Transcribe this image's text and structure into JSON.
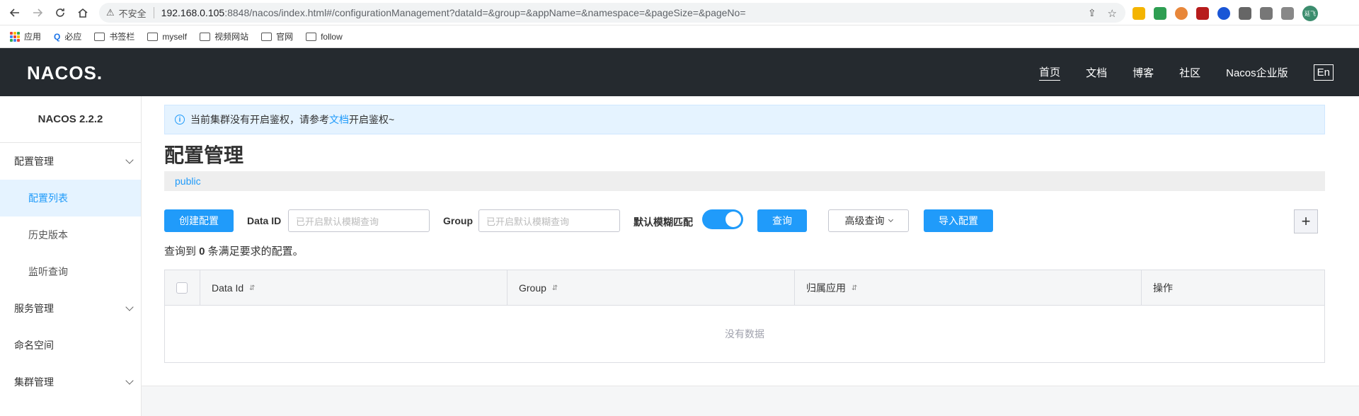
{
  "browser": {
    "security_label": "不安全",
    "url_host": "192.168.0.105",
    "url_rest": ":8848/nacos/index.html#/configurationManagement?dataId=&group=&appName=&namespace=&pageSize=&pageNo=",
    "avatar_text": "延飞"
  },
  "bookmarks": [
    {
      "label": "应用"
    },
    {
      "label": "必应"
    },
    {
      "label": "书签栏"
    },
    {
      "label": "myself"
    },
    {
      "label": "视频网站"
    },
    {
      "label": "官网"
    },
    {
      "label": "follow"
    }
  ],
  "header": {
    "logo": "NACOS.",
    "nav": [
      "首页",
      "文档",
      "博客",
      "社区",
      "Nacos企业版"
    ],
    "lang": "En"
  },
  "sidebar": {
    "version": "NACOS 2.2.2",
    "items": [
      {
        "label": "配置管理"
      },
      {
        "label": "配置列表"
      },
      {
        "label": "历史版本"
      },
      {
        "label": "监听查询"
      },
      {
        "label": "服务管理"
      },
      {
        "label": "命名空间"
      },
      {
        "label": "集群管理"
      }
    ]
  },
  "main": {
    "notice_prefix": "当前集群没有开启鉴权，请参考",
    "notice_link": "文档",
    "notice_suffix": "开启鉴权~",
    "title": "配置管理",
    "namespace": "public",
    "create_button": "创建配置",
    "dataid_label": "Data ID",
    "dataid_placeholder": "已开启默认模糊查询",
    "group_label": "Group",
    "group_placeholder": "已开启默认模糊查询",
    "fuzzy_label": "默认模糊匹配",
    "query_button": "查询",
    "advanced_button": "高级查询",
    "import_button": "导入配置",
    "plus": "+",
    "result_prefix": "查询到 ",
    "result_count": "0",
    "result_suffix": " 条满足要求的配置。",
    "table": {
      "columns": [
        "Data Id",
        "Group",
        "归属应用",
        "操作"
      ],
      "empty": "没有数据"
    }
  }
}
